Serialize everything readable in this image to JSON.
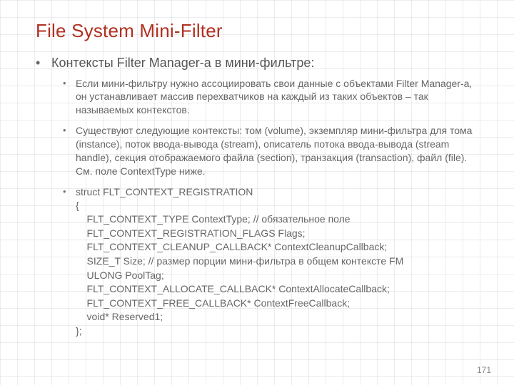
{
  "title": "File System Mini-Filter",
  "bullet1": "Контексты Filter Manager-а в мини-фильтре:",
  "sub1": "Если мини-фильтру нужно ассоциировать свои данные с объектами Filter Manager-а, он устанавливает массив перехватчиков на каждый из таких объектов – так называемых контекстов.",
  "sub2": "Существуют следующие контексты: том (volume), экземпляр мини-фильтра для тома (instance), поток ввода-вывода (stream), описатель потока ввода-вывода (stream handle), секция отображаемого файла (section), транзакция (transaction), файл (file). См. поле ContextType ниже.",
  "struct_head": "struct FLT_CONTEXT_REGISTRATION",
  "struct_body": "{\n    FLT_CONTEXT_TYPE ContextType; // обязательное поле\n    FLT_CONTEXT_REGISTRATION_FLAGS Flags;\n    FLT_CONTEXT_CLEANUP_CALLBACK* ContextCleanupCallback;\n    SIZE_T Size; // размер порции мини-фильтра в общем контексте FM\n    ULONG PoolTag;\n    FLT_CONTEXT_ALLOCATE_CALLBACK* ContextAllocateCallback;\n    FLT_CONTEXT_FREE_CALLBACK* ContextFreeCallback;\n    void* Reserved1;\n};",
  "page_number": "171"
}
